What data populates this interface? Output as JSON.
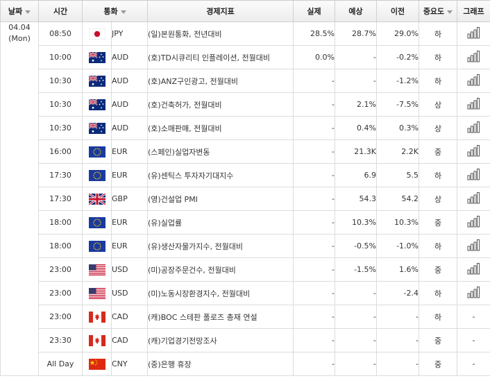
{
  "header": {
    "date": "날짜",
    "time": "시간",
    "currency": "통화",
    "indicator": "경제지표",
    "actual": "실제",
    "forecast": "예상",
    "previous": "이전",
    "importance": "중요도",
    "chart": "그래프"
  },
  "date": {
    "day": "04.04",
    "weekday": "(Mon)"
  },
  "icons": {
    "chart": "bar-chart-icon",
    "sort": "dropdown-arrow-icon"
  },
  "rows": [
    {
      "time": "08:50",
      "flag": "jp",
      "currency": "JPY",
      "indicator": "(일)본원통화, 전년대비",
      "actual": "28.5%",
      "forecast": "28.7%",
      "previous": "29.0%",
      "importance": "하",
      "chart": true
    },
    {
      "time": "10:00",
      "flag": "au",
      "currency": "AUD",
      "indicator": "(호)TD시큐리티 인플레이션, 전월대비",
      "actual": "0.0%",
      "forecast": "-",
      "previous": "-0.2%",
      "importance": "하",
      "chart": true
    },
    {
      "time": "10:30",
      "flag": "au",
      "currency": "AUD",
      "indicator": "(호)ANZ구인광고, 전월대비",
      "actual": "-",
      "forecast": "-",
      "previous": "-1.2%",
      "importance": "하",
      "chart": true
    },
    {
      "time": "10:30",
      "flag": "au",
      "currency": "AUD",
      "indicator": "(호)건축허가, 전월대비",
      "actual": "-",
      "forecast": "2.1%",
      "previous": "-7.5%",
      "importance": "상",
      "chart": true
    },
    {
      "time": "10:30",
      "flag": "au",
      "currency": "AUD",
      "indicator": "(호)소매판매, 전월대비",
      "actual": "-",
      "forecast": "0.4%",
      "previous": "0.3%",
      "importance": "상",
      "chart": true
    },
    {
      "time": "16:00",
      "flag": "eu",
      "currency": "EUR",
      "indicator": "(스페인)실업자변동",
      "actual": "-",
      "forecast": "21.3K",
      "previous": "2.2K",
      "importance": "중",
      "chart": true
    },
    {
      "time": "17:30",
      "flag": "eu",
      "currency": "EUR",
      "indicator": "(유)센틱스 투자자기대지수",
      "actual": "-",
      "forecast": "6.9",
      "previous": "5.5",
      "importance": "하",
      "chart": true
    },
    {
      "time": "17:30",
      "flag": "gb",
      "currency": "GBP",
      "indicator": "(영)건설업 PMI",
      "actual": "-",
      "forecast": "54.3",
      "previous": "54.2",
      "importance": "상",
      "chart": true
    },
    {
      "time": "18:00",
      "flag": "eu",
      "currency": "EUR",
      "indicator": "(유)실업률",
      "actual": "-",
      "forecast": "10.3%",
      "previous": "10.3%",
      "importance": "중",
      "chart": true
    },
    {
      "time": "18:00",
      "flag": "eu",
      "currency": "EUR",
      "indicator": "(유)생산자물가지수, 전월대비",
      "actual": "-",
      "forecast": "-0.5%",
      "previous": "-1.0%",
      "importance": "하",
      "chart": true
    },
    {
      "time": "23:00",
      "flag": "us",
      "currency": "USD",
      "indicator": "(미)공장주문건수, 전월대비",
      "actual": "-",
      "forecast": "-1.5%",
      "previous": "1.6%",
      "importance": "중",
      "chart": true
    },
    {
      "time": "23:00",
      "flag": "us",
      "currency": "USD",
      "indicator": "(미)노동시장환경지수, 전월대비",
      "actual": "-",
      "forecast": "-",
      "previous": "-2.4",
      "importance": "하",
      "chart": true
    },
    {
      "time": "23:00",
      "flag": "ca",
      "currency": "CAD",
      "indicator": "(캐)BOC 스테판 폴로즈 총재 연설",
      "actual": "-",
      "forecast": "-",
      "previous": "-",
      "importance": "하",
      "chart": false
    },
    {
      "time": "23:30",
      "flag": "ca",
      "currency": "CAD",
      "indicator": "(캐)기업경기전망조사",
      "actual": "-",
      "forecast": "-",
      "previous": "-",
      "importance": "중",
      "chart": false
    },
    {
      "time": "All Day",
      "flag": "cn",
      "currency": "CNY",
      "indicator": "(중)은행 휴장",
      "actual": "-",
      "forecast": "-",
      "previous": "-",
      "importance": "중",
      "chart": false
    }
  ],
  "empty_chart": "-"
}
